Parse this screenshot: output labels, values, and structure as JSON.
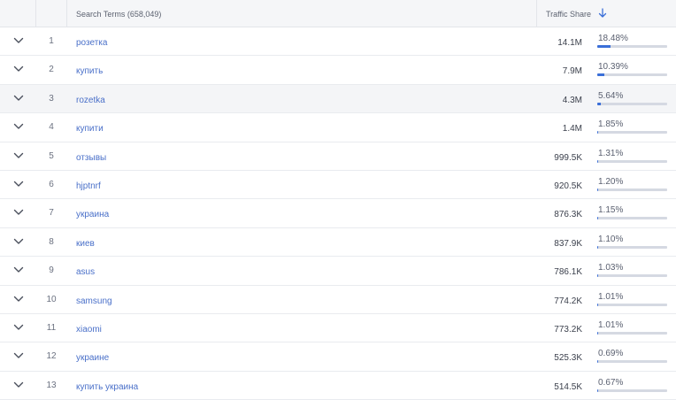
{
  "header": {
    "term_column": "Search Terms (658,049)",
    "share_column": "Traffic Share",
    "sort_icon": "arrow-down-icon"
  },
  "colors": {
    "link": "#4a70c9",
    "bar_fill": "#3a6fd8",
    "bar_track": "#d5d9e2"
  },
  "rows": [
    {
      "rank": "1",
      "term": "розетка",
      "traffic": "14.1M",
      "share": "18.48%",
      "share_value": 18.48
    },
    {
      "rank": "2",
      "term": "купить",
      "traffic": "7.9M",
      "share": "10.39%",
      "share_value": 10.39
    },
    {
      "rank": "3",
      "term": "rozetka",
      "traffic": "4.3M",
      "share": "5.64%",
      "share_value": 5.64
    },
    {
      "rank": "4",
      "term": "купити",
      "traffic": "1.4M",
      "share": "1.85%",
      "share_value": 1.85
    },
    {
      "rank": "5",
      "term": "отзывы",
      "traffic": "999.5K",
      "share": "1.31%",
      "share_value": 1.31
    },
    {
      "rank": "6",
      "term": "hjptnrf",
      "traffic": "920.5K",
      "share": "1.20%",
      "share_value": 1.2
    },
    {
      "rank": "7",
      "term": "украина",
      "traffic": "876.3K",
      "share": "1.15%",
      "share_value": 1.15
    },
    {
      "rank": "8",
      "term": "киев",
      "traffic": "837.9K",
      "share": "1.10%",
      "share_value": 1.1
    },
    {
      "rank": "9",
      "term": "asus",
      "traffic": "786.1K",
      "share": "1.03%",
      "share_value": 1.03
    },
    {
      "rank": "10",
      "term": "samsung",
      "traffic": "774.2K",
      "share": "1.01%",
      "share_value": 1.01
    },
    {
      "rank": "11",
      "term": "xiaomi",
      "traffic": "773.2K",
      "share": "1.01%",
      "share_value": 1.01
    },
    {
      "rank": "12",
      "term": "украине",
      "traffic": "525.3K",
      "share": "0.69%",
      "share_value": 0.69
    },
    {
      "rank": "13",
      "term": "купить украина",
      "traffic": "514.5K",
      "share": "0.67%",
      "share_value": 0.67
    }
  ]
}
